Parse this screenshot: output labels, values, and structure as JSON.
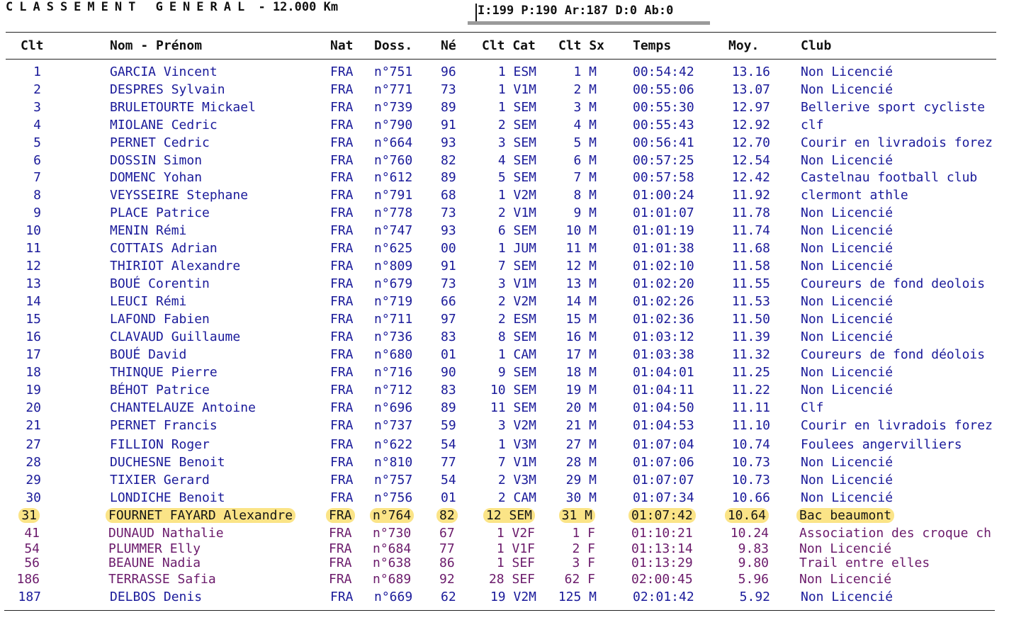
{
  "title": {
    "spaced_text": "CLASSEMENT GENERAL",
    "distance": " - 12.000 Km"
  },
  "stats": "I:199 P:190 Ar:187 D:0 Ab:0",
  "columns": {
    "clt": "Clt",
    "nom": "Nom - Prénom",
    "nat": "Nat",
    "doss": "Doss.",
    "ne": "Né",
    "clt_cat": "Clt Cat",
    "clt_sx": "Clt Sx",
    "temps": "Temps",
    "moy": "Moy.",
    "club": "Club"
  },
  "rows": [
    {
      "clt": "1",
      "nom": "GARCIA Vincent",
      "nat": "FRA",
      "doss": "n°751",
      "ne": "96",
      "cat": "1 ESM",
      "sx": "1 M",
      "temps": "00:54:42",
      "moy": "13.16",
      "club": "Non Licencié"
    },
    {
      "clt": "2",
      "nom": "DESPRES Sylvain",
      "nat": "FRA",
      "doss": "n°771",
      "ne": "73",
      "cat": "1 V1M",
      "sx": "2 M",
      "temps": "00:55:06",
      "moy": "13.07",
      "club": "Non Licencié"
    },
    {
      "clt": "3",
      "nom": "BRULETOURTE Mickael",
      "nat": "FRA",
      "doss": "n°739",
      "ne": "89",
      "cat": "1 SEM",
      "sx": "3 M",
      "temps": "00:55:30",
      "moy": "12.97",
      "club": "Bellerive sport cycliste"
    },
    {
      "clt": "4",
      "nom": "MIOLANE Cedric",
      "nat": "FRA",
      "doss": "n°790",
      "ne": "91",
      "cat": "2 SEM",
      "sx": "4 M",
      "temps": "00:55:43",
      "moy": "12.92",
      "club": "clf"
    },
    {
      "clt": "5",
      "nom": "PERNET Cedric",
      "nat": "FRA",
      "doss": "n°664",
      "ne": "93",
      "cat": "3 SEM",
      "sx": "5 M",
      "temps": "00:56:41",
      "moy": "12.70",
      "club": "Courir en livradois forez"
    },
    {
      "clt": "6",
      "nom": "DOSSIN Simon",
      "nat": "FRA",
      "doss": "n°760",
      "ne": "82",
      "cat": "4 SEM",
      "sx": "6 M",
      "temps": "00:57:25",
      "moy": "12.54",
      "club": "Non Licencié"
    },
    {
      "clt": "7",
      "nom": "DOMENC Yohan",
      "nat": "FRA",
      "doss": "n°612",
      "ne": "89",
      "cat": "5 SEM",
      "sx": "7 M",
      "temps": "00:57:58",
      "moy": "12.42",
      "club": "Castelnau football club"
    },
    {
      "clt": "8",
      "nom": "VEYSSEIRE Stephane",
      "nat": "FRA",
      "doss": "n°791",
      "ne": "68",
      "cat": "1 V2M",
      "sx": "8 M",
      "temps": "01:00:24",
      "moy": "11.92",
      "club": "clermont athle"
    },
    {
      "clt": "9",
      "nom": "PLACE Patrice",
      "nat": "FRA",
      "doss": "n°778",
      "ne": "73",
      "cat": "2 V1M",
      "sx": "9 M",
      "temps": "01:01:07",
      "moy": "11.78",
      "club": "Non Licencié"
    },
    {
      "clt": "10",
      "nom": "MENIN Rémi",
      "nat": "FRA",
      "doss": "n°747",
      "ne": "93",
      "cat": "6 SEM",
      "sx": "10 M",
      "temps": "01:01:19",
      "moy": "11.74",
      "club": "Non Licencié"
    },
    {
      "clt": "11",
      "nom": "COTTAIS Adrian",
      "nat": "FRA",
      "doss": "n°625",
      "ne": "00",
      "cat": "1 JUM",
      "sx": "11 M",
      "temps": "01:01:38",
      "moy": "11.68",
      "club": "Non Licencié"
    },
    {
      "clt": "12",
      "nom": "THIRIOT Alexandre",
      "nat": "FRA",
      "doss": "n°809",
      "ne": "91",
      "cat": "7 SEM",
      "sx": "12 M",
      "temps": "01:02:10",
      "moy": "11.58",
      "club": "Non Licencié"
    },
    {
      "clt": "13",
      "nom": "BOUÉ Corentin",
      "nat": "FRA",
      "doss": "n°679",
      "ne": "73",
      "cat": "3 V1M",
      "sx": "13 M",
      "temps": "01:02:20",
      "moy": "11.55",
      "club": "Coureurs de fond deolois"
    },
    {
      "clt": "14",
      "nom": "LEUCI Rémi",
      "nat": "FRA",
      "doss": "n°719",
      "ne": "66",
      "cat": "2 V2M",
      "sx": "14 M",
      "temps": "01:02:26",
      "moy": "11.53",
      "club": "Non Licencié"
    },
    {
      "clt": "15",
      "nom": "LAFOND Fabien",
      "nat": "FRA",
      "doss": "n°711",
      "ne": "97",
      "cat": "2 ESM",
      "sx": "15 M",
      "temps": "01:02:36",
      "moy": "11.50",
      "club": "Non Licencié"
    },
    {
      "clt": "16",
      "nom": "CLAVAUD Guillaume",
      "nat": "FRA",
      "doss": "n°736",
      "ne": "83",
      "cat": "8 SEM",
      "sx": "16 M",
      "temps": "01:03:12",
      "moy": "11.39",
      "club": "Non Licencié"
    },
    {
      "clt": "17",
      "nom": "BOUÉ David",
      "nat": "FRA",
      "doss": "n°680",
      "ne": "01",
      "cat": "1 CAM",
      "sx": "17 M",
      "temps": "01:03:38",
      "moy": "11.32",
      "club": "Coureurs de fond déolois"
    },
    {
      "clt": "18",
      "nom": "THINQUE Pierre",
      "nat": "FRA",
      "doss": "n°716",
      "ne": "90",
      "cat": "9 SEM",
      "sx": "18 M",
      "temps": "01:04:01",
      "moy": "11.25",
      "club": "Non Licencié"
    },
    {
      "clt": "19",
      "nom": "BÉHOT Patrice",
      "nat": "FRA",
      "doss": "n°712",
      "ne": "83",
      "cat": "10 SEM",
      "sx": "19 M",
      "temps": "01:04:11",
      "moy": "11.22",
      "club": "Non Licencié"
    },
    {
      "clt": "20",
      "nom": "CHANTELAUZE Antoine",
      "nat": "FRA",
      "doss": "n°696",
      "ne": "89",
      "cat": "11 SEM",
      "sx": "20 M",
      "temps": "01:04:50",
      "moy": "11.11",
      "club": "Clf"
    },
    {
      "clt": "21",
      "nom": "PERNET Francis",
      "nat": "FRA",
      "doss": "n°737",
      "ne": "59",
      "cat": "3 V2M",
      "sx": "21 M",
      "temps": "01:04:53",
      "moy": "11.10",
      "club": "Courir en livradois forez"
    },
    {
      "clt": "27",
      "nom": "FILLION Roger",
      "nat": "FRA",
      "doss": "n°622",
      "ne": "54",
      "cat": "1 V3M",
      "sx": "27 M",
      "temps": "01:07:04",
      "moy": "10.74",
      "club": "Foulees angervilliers"
    },
    {
      "clt": "28",
      "nom": "DUCHESNE Benoit",
      "nat": "FRA",
      "doss": "n°810",
      "ne": "77",
      "cat": "7 V1M",
      "sx": "28 M",
      "temps": "01:07:06",
      "moy": "10.73",
      "club": "Non Licencié"
    },
    {
      "clt": "29",
      "nom": "TIXIER Gerard",
      "nat": "FRA",
      "doss": "n°757",
      "ne": "54",
      "cat": "2 V3M",
      "sx": "29 M",
      "temps": "01:07:07",
      "moy": "10.73",
      "club": "Non Licencié"
    },
    {
      "clt": "30",
      "nom": "LONDICHE Benoit",
      "nat": "FRA",
      "doss": "n°756",
      "ne": "01",
      "cat": "2 CAM",
      "sx": "30 M",
      "temps": "01:07:34",
      "moy": "10.66",
      "club": "Non Licencié"
    },
    {
      "clt": "31",
      "nom": "FOURNET FAYARD Alexandre",
      "nat": "FRA",
      "doss": "n°764",
      "ne": "82",
      "cat": "12 SEM",
      "sx": "31 M",
      "temps": "01:07:42",
      "moy": "10.64",
      "club": "Bac beaumont",
      "highlight": true
    },
    {
      "clt": "41",
      "nom": "DUNAUD Nathalie",
      "nat": "FRA",
      "doss": "n°730",
      "ne": "67",
      "cat": "1 V2F",
      "sx": "1 F",
      "temps": "01:10:21",
      "moy": "10.24",
      "club": "Association des croque ch",
      "female": true
    },
    {
      "clt": "54",
      "nom": "PLUMMER Elly",
      "nat": "FRA",
      "doss": "n°684",
      "ne": "77",
      "cat": "1 V1F",
      "sx": "2 F",
      "temps": "01:13:14",
      "moy": "9.83",
      "club": "Non Licencié",
      "female": true
    },
    {
      "clt": "56",
      "nom": "BEAUNE Nadia",
      "nat": "FRA",
      "doss": "n°638",
      "ne": "86",
      "cat": "1 SEF",
      "sx": "3 F",
      "temps": "01:13:29",
      "moy": "9.80",
      "club": "Trail entre elles",
      "female": true
    },
    {
      "clt": "186",
      "nom": "TERRASSE Safia",
      "nat": "FRA",
      "doss": "n°689",
      "ne": "92",
      "cat": "28 SEF",
      "sx": "62 F",
      "temps": "02:00:45",
      "moy": "5.96",
      "club": "Non Licencié",
      "female": true
    },
    {
      "clt": "187",
      "nom": "DELBOS Denis",
      "nat": "FRA",
      "doss": "n°669",
      "ne": "62",
      "cat": "19 V2M",
      "sx": "125 M",
      "temps": "02:01:42",
      "moy": "5.92",
      "club": "Non Licencié"
    }
  ],
  "colors": {
    "text_blue": "#1a1a9a",
    "text_female": "#6b1a6b",
    "highlight": "#fbe487",
    "stats_bar": "#9a9a9a"
  }
}
